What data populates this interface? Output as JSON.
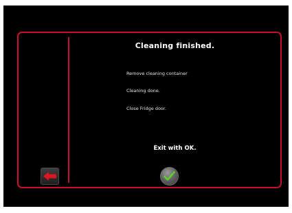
{
  "dialog": {
    "title": "Cleaning finished.",
    "lines": [
      "Remove cleaning container",
      "Cleaning done.",
      "Close Fridge door."
    ],
    "exit_hint": "Exit with OK."
  },
  "buttons": {
    "back_icon": "red-arrow-left-icon",
    "ok_icon": "green-checkmark-icon"
  },
  "colors": {
    "accent_red": "#c8102e",
    "ok_green": "#5cd12a",
    "background": "#000000"
  }
}
